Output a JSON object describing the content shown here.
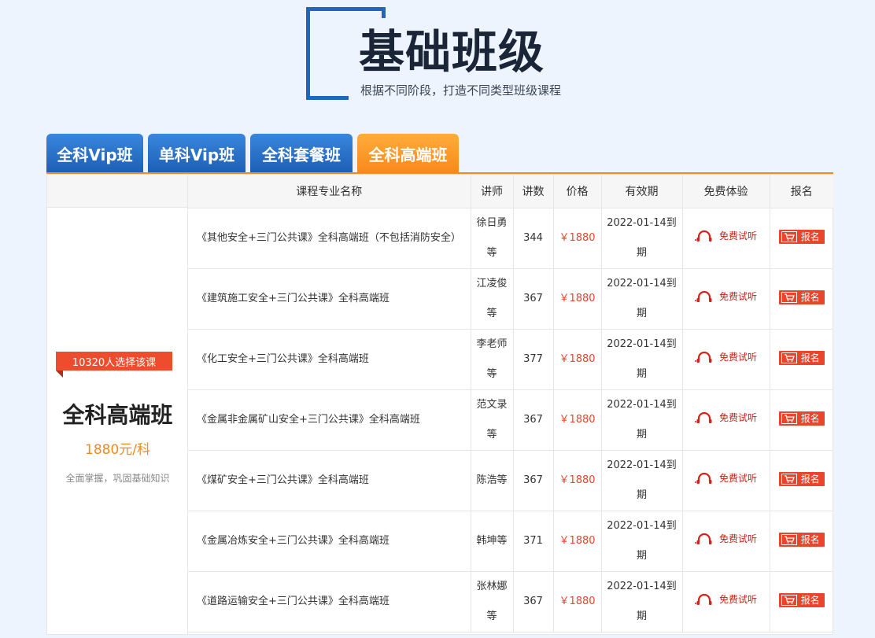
{
  "header": {
    "title": "基础班级",
    "subtitle": "根据不同阶段，打造不同类型班级课程"
  },
  "tabs": [
    {
      "label": "全科Vip班",
      "active": false
    },
    {
      "label": "单科Vip班",
      "active": false
    },
    {
      "label": "全科套餐班",
      "active": false
    },
    {
      "label": "全科高端班",
      "active": true
    }
  ],
  "side": {
    "ribbon": "10320人选择该课",
    "title": "全科高端班",
    "price": "1880元/科",
    "desc": "全面掌握，巩固基础知识"
  },
  "table": {
    "columns": [
      "课程专业名称",
      "讲师",
      "讲数",
      "价格",
      "有效期",
      "免费体验",
      "报名"
    ],
    "trial_label": "免费试听",
    "signup_label": "报名",
    "rows": [
      {
        "name": "《其他安全+三门公共课》全科高端班（不包括消防安全）",
        "teacher": "徐日勇等",
        "lectures": "344",
        "price": "￥1880",
        "validity": "2022-01-14到期"
      },
      {
        "name": "《建筑施工安全+三门公共课》全科高端班",
        "teacher": "江凌俊等",
        "lectures": "367",
        "price": "￥1880",
        "validity": "2022-01-14到期"
      },
      {
        "name": "《化工安全+三门公共课》全科高端班",
        "teacher": "李老师等",
        "lectures": "377",
        "price": "￥1880",
        "validity": "2022-01-14到期"
      },
      {
        "name": "《金属非金属矿山安全+三门公共课》全科高端班",
        "teacher": "范文录等",
        "lectures": "367",
        "price": "￥1880",
        "validity": "2022-01-14到期"
      },
      {
        "name": "《煤矿安全+三门公共课》全科高端班",
        "teacher": "陈浩等",
        "lectures": "367",
        "price": "￥1880",
        "validity": "2022-01-14到期"
      },
      {
        "name": "《金属冶炼安全+三门公共课》全科高端班",
        "teacher": "韩坤等",
        "lectures": "371",
        "price": "￥1880",
        "validity": "2022-01-14到期"
      },
      {
        "name": "《道路运输安全+三门公共课》全科高端班",
        "teacher": "张林娜等",
        "lectures": "367",
        "price": "￥1880",
        "validity": "2022-01-14到期"
      }
    ]
  },
  "colors": {
    "brand_blue": "#1e66c0",
    "accent_orange": "#f8891a",
    "price_red": "#e8452c"
  },
  "icons": {
    "trial": "headset-icon",
    "signup": "cart-icon"
  }
}
